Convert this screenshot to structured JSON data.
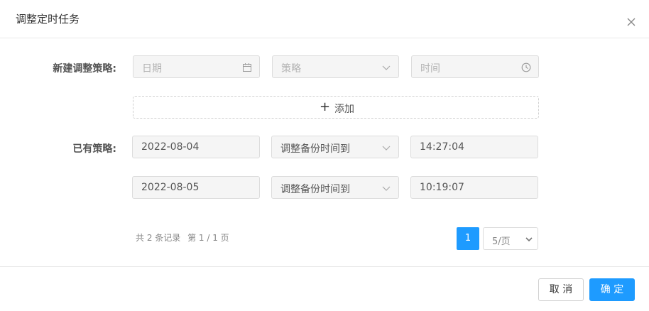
{
  "dialog": {
    "title": "调整定时任务"
  },
  "new_policy": {
    "label": "新建调整策略:",
    "date_placeholder": "日期",
    "policy_placeholder": "策略",
    "time_placeholder": "时间",
    "add_label": "添加"
  },
  "existing": {
    "label": "已有策略:",
    "rows": [
      {
        "date": "2022-08-04",
        "policy": "调整备份时间到",
        "time": "14:27:04"
      },
      {
        "date": "2022-08-05",
        "policy": "调整备份时间到",
        "time": "10:19:07"
      }
    ]
  },
  "pagination": {
    "total_text": "共 2 条记录",
    "page_text": "第 1 / 1 页",
    "current_page": "1",
    "page_size": "5/页"
  },
  "footer": {
    "cancel_label": "取 消",
    "ok_label": "确 定"
  },
  "colors": {
    "primary": "#1e9bff",
    "field_bg": "#f5f5f5",
    "border": "#dcdcdc"
  },
  "icons": {
    "close": "close-icon",
    "calendar": "calendar-icon",
    "chevron": "chevron-down-icon",
    "clock": "clock-icon",
    "plus": "plus-icon"
  }
}
